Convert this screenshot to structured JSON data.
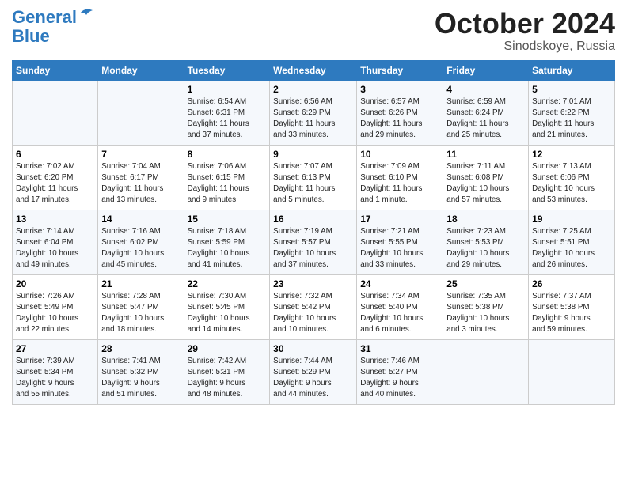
{
  "header": {
    "logo_line1": "General",
    "logo_line2": "Blue",
    "month": "October 2024",
    "location": "Sinodskoye, Russia"
  },
  "days_of_week": [
    "Sunday",
    "Monday",
    "Tuesday",
    "Wednesday",
    "Thursday",
    "Friday",
    "Saturday"
  ],
  "weeks": [
    [
      {
        "num": "",
        "info": ""
      },
      {
        "num": "",
        "info": ""
      },
      {
        "num": "1",
        "info": "Sunrise: 6:54 AM\nSunset: 6:31 PM\nDaylight: 11 hours\nand 37 minutes."
      },
      {
        "num": "2",
        "info": "Sunrise: 6:56 AM\nSunset: 6:29 PM\nDaylight: 11 hours\nand 33 minutes."
      },
      {
        "num": "3",
        "info": "Sunrise: 6:57 AM\nSunset: 6:26 PM\nDaylight: 11 hours\nand 29 minutes."
      },
      {
        "num": "4",
        "info": "Sunrise: 6:59 AM\nSunset: 6:24 PM\nDaylight: 11 hours\nand 25 minutes."
      },
      {
        "num": "5",
        "info": "Sunrise: 7:01 AM\nSunset: 6:22 PM\nDaylight: 11 hours\nand 21 minutes."
      }
    ],
    [
      {
        "num": "6",
        "info": "Sunrise: 7:02 AM\nSunset: 6:20 PM\nDaylight: 11 hours\nand 17 minutes."
      },
      {
        "num": "7",
        "info": "Sunrise: 7:04 AM\nSunset: 6:17 PM\nDaylight: 11 hours\nand 13 minutes."
      },
      {
        "num": "8",
        "info": "Sunrise: 7:06 AM\nSunset: 6:15 PM\nDaylight: 11 hours\nand 9 minutes."
      },
      {
        "num": "9",
        "info": "Sunrise: 7:07 AM\nSunset: 6:13 PM\nDaylight: 11 hours\nand 5 minutes."
      },
      {
        "num": "10",
        "info": "Sunrise: 7:09 AM\nSunset: 6:10 PM\nDaylight: 11 hours\nand 1 minute."
      },
      {
        "num": "11",
        "info": "Sunrise: 7:11 AM\nSunset: 6:08 PM\nDaylight: 10 hours\nand 57 minutes."
      },
      {
        "num": "12",
        "info": "Sunrise: 7:13 AM\nSunset: 6:06 PM\nDaylight: 10 hours\nand 53 minutes."
      }
    ],
    [
      {
        "num": "13",
        "info": "Sunrise: 7:14 AM\nSunset: 6:04 PM\nDaylight: 10 hours\nand 49 minutes."
      },
      {
        "num": "14",
        "info": "Sunrise: 7:16 AM\nSunset: 6:02 PM\nDaylight: 10 hours\nand 45 minutes."
      },
      {
        "num": "15",
        "info": "Sunrise: 7:18 AM\nSunset: 5:59 PM\nDaylight: 10 hours\nand 41 minutes."
      },
      {
        "num": "16",
        "info": "Sunrise: 7:19 AM\nSunset: 5:57 PM\nDaylight: 10 hours\nand 37 minutes."
      },
      {
        "num": "17",
        "info": "Sunrise: 7:21 AM\nSunset: 5:55 PM\nDaylight: 10 hours\nand 33 minutes."
      },
      {
        "num": "18",
        "info": "Sunrise: 7:23 AM\nSunset: 5:53 PM\nDaylight: 10 hours\nand 29 minutes."
      },
      {
        "num": "19",
        "info": "Sunrise: 7:25 AM\nSunset: 5:51 PM\nDaylight: 10 hours\nand 26 minutes."
      }
    ],
    [
      {
        "num": "20",
        "info": "Sunrise: 7:26 AM\nSunset: 5:49 PM\nDaylight: 10 hours\nand 22 minutes."
      },
      {
        "num": "21",
        "info": "Sunrise: 7:28 AM\nSunset: 5:47 PM\nDaylight: 10 hours\nand 18 minutes."
      },
      {
        "num": "22",
        "info": "Sunrise: 7:30 AM\nSunset: 5:45 PM\nDaylight: 10 hours\nand 14 minutes."
      },
      {
        "num": "23",
        "info": "Sunrise: 7:32 AM\nSunset: 5:42 PM\nDaylight: 10 hours\nand 10 minutes."
      },
      {
        "num": "24",
        "info": "Sunrise: 7:34 AM\nSunset: 5:40 PM\nDaylight: 10 hours\nand 6 minutes."
      },
      {
        "num": "25",
        "info": "Sunrise: 7:35 AM\nSunset: 5:38 PM\nDaylight: 10 hours\nand 3 minutes."
      },
      {
        "num": "26",
        "info": "Sunrise: 7:37 AM\nSunset: 5:38 PM\nDaylight: 9 hours\nand 59 minutes."
      }
    ],
    [
      {
        "num": "27",
        "info": "Sunrise: 7:39 AM\nSunset: 5:34 PM\nDaylight: 9 hours\nand 55 minutes."
      },
      {
        "num": "28",
        "info": "Sunrise: 7:41 AM\nSunset: 5:32 PM\nDaylight: 9 hours\nand 51 minutes."
      },
      {
        "num": "29",
        "info": "Sunrise: 7:42 AM\nSunset: 5:31 PM\nDaylight: 9 hours\nand 48 minutes."
      },
      {
        "num": "30",
        "info": "Sunrise: 7:44 AM\nSunset: 5:29 PM\nDaylight: 9 hours\nand 44 minutes."
      },
      {
        "num": "31",
        "info": "Sunrise: 7:46 AM\nSunset: 5:27 PM\nDaylight: 9 hours\nand 40 minutes."
      },
      {
        "num": "",
        "info": ""
      },
      {
        "num": "",
        "info": ""
      }
    ]
  ]
}
